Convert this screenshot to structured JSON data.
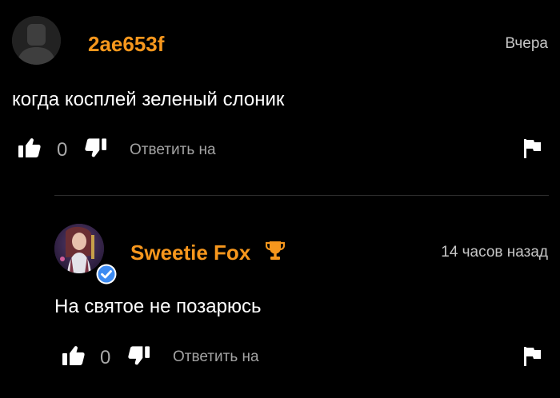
{
  "colors": {
    "background": "#000000",
    "username": "#f7971d",
    "text": "#ffffff",
    "muted": "#a3a3a3",
    "verified": "#3d8bf2"
  },
  "comments": [
    {
      "username": "2ae653f",
      "timestamp": "Вчера",
      "text": "когда косплей зеленый слоник",
      "votes": "0",
      "reply_label": "Ответить на",
      "avatar_icon": "default-avatar-icon"
    },
    {
      "username": "Sweetie Fox",
      "timestamp": "14 часов назад",
      "text": "На святое не позарюсь",
      "votes": "0",
      "reply_label": "Ответить на",
      "badges": [
        "verified-icon",
        "trophy-icon"
      ]
    }
  ]
}
